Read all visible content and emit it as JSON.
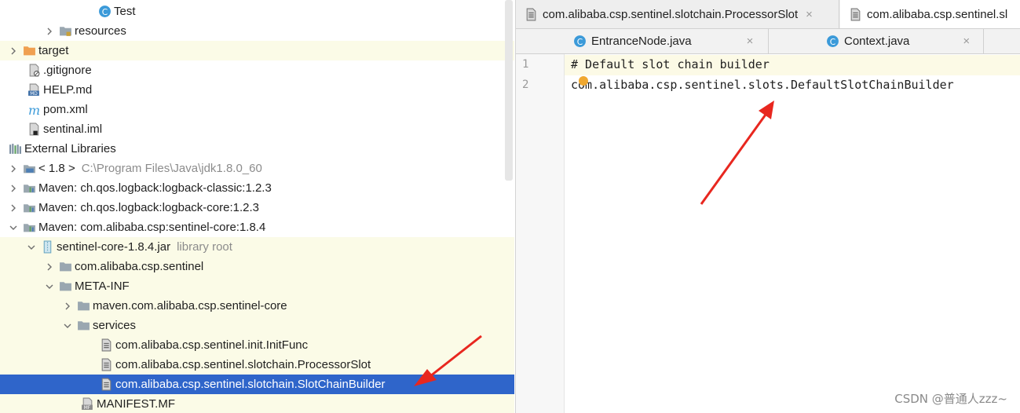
{
  "project_tree": {
    "items": [
      {
        "label": "Test",
        "secondary": "",
        "icon": "java-class-icon",
        "expander": "none"
      },
      {
        "label": "resources",
        "secondary": "",
        "icon": "resources-folder-icon",
        "expander": "collapsed"
      },
      {
        "label": "target",
        "secondary": "",
        "icon": "target-folder-icon",
        "expander": "collapsed"
      },
      {
        "label": ".gitignore",
        "secondary": "",
        "icon": "gitignore-file-icon",
        "expander": "none"
      },
      {
        "label": "HELP.md",
        "secondary": "",
        "icon": "markdown-file-icon",
        "expander": "none"
      },
      {
        "label": "pom.xml",
        "secondary": "",
        "icon": "maven-file-icon",
        "expander": "none"
      },
      {
        "label": "sentinal.iml",
        "secondary": "",
        "icon": "iml-file-icon",
        "expander": "none"
      },
      {
        "label": "External Libraries",
        "secondary": "",
        "icon": "libraries-icon",
        "expander": "expanded"
      },
      {
        "label": "< 1.8 >",
        "secondary": "C:\\Program Files\\Java\\jdk1.8.0_60",
        "icon": "jdk-icon",
        "expander": "collapsed"
      },
      {
        "label": "Maven: ch.qos.logback:logback-classic:1.2.3",
        "secondary": "",
        "icon": "library-icon",
        "expander": "collapsed"
      },
      {
        "label": "Maven: ch.qos.logback:logback-core:1.2.3",
        "secondary": "",
        "icon": "library-icon",
        "expander": "collapsed"
      },
      {
        "label": "Maven: com.alibaba.csp:sentinel-core:1.8.4",
        "secondary": "",
        "icon": "library-icon",
        "expander": "expanded"
      },
      {
        "label": "sentinel-core-1.8.4.jar",
        "secondary": "library root",
        "icon": "jar-icon",
        "expander": "expanded"
      },
      {
        "label": "com.alibaba.csp.sentinel",
        "secondary": "",
        "icon": "package-folder-icon",
        "expander": "collapsed"
      },
      {
        "label": "META-INF",
        "secondary": "",
        "icon": "folder-icon",
        "expander": "expanded"
      },
      {
        "label": "maven.com.alibaba.csp.sentinel-core",
        "secondary": "",
        "icon": "folder-icon",
        "expander": "collapsed"
      },
      {
        "label": "services",
        "secondary": "",
        "icon": "folder-icon",
        "expander": "expanded"
      },
      {
        "label": "com.alibaba.csp.sentinel.init.InitFunc",
        "secondary": "",
        "icon": "text-file-icon",
        "expander": "none"
      },
      {
        "label": "com.alibaba.csp.sentinel.slotchain.ProcessorSlot",
        "secondary": "",
        "icon": "text-file-icon",
        "expander": "none"
      },
      {
        "label": "com.alibaba.csp.sentinel.slotchain.SlotChainBuilder",
        "secondary": "",
        "icon": "text-file-icon",
        "expander": "none"
      },
      {
        "label": "MANIFEST.MF",
        "secondary": "",
        "icon": "manifest-file-icon",
        "expander": "none"
      }
    ]
  },
  "editor": {
    "tabs_row1": [
      {
        "label": "com.alibaba.csp.sentinel.slotchain.ProcessorSlot",
        "close": "×"
      },
      {
        "label": "com.alibaba.csp.sentinel.sl",
        "close": ""
      }
    ],
    "tabs_row2": [
      {
        "label": "EntranceNode.java",
        "close": "×"
      },
      {
        "label": "Context.java",
        "close": "×"
      }
    ],
    "lines": [
      {
        "number": "1",
        "text": "# Default slot chain builder"
      },
      {
        "number": "2",
        "text": "com.alibaba.csp.sentinel.slots.DefaultSlotChainBuilder"
      }
    ]
  },
  "watermark": "CSDN @普通人zzz~",
  "colors": {
    "selection": "#2f65ca",
    "highlight_row": "#fbfbe7",
    "annotation_arrow": "#e8271f",
    "java_icon": "#3b9ad9"
  }
}
